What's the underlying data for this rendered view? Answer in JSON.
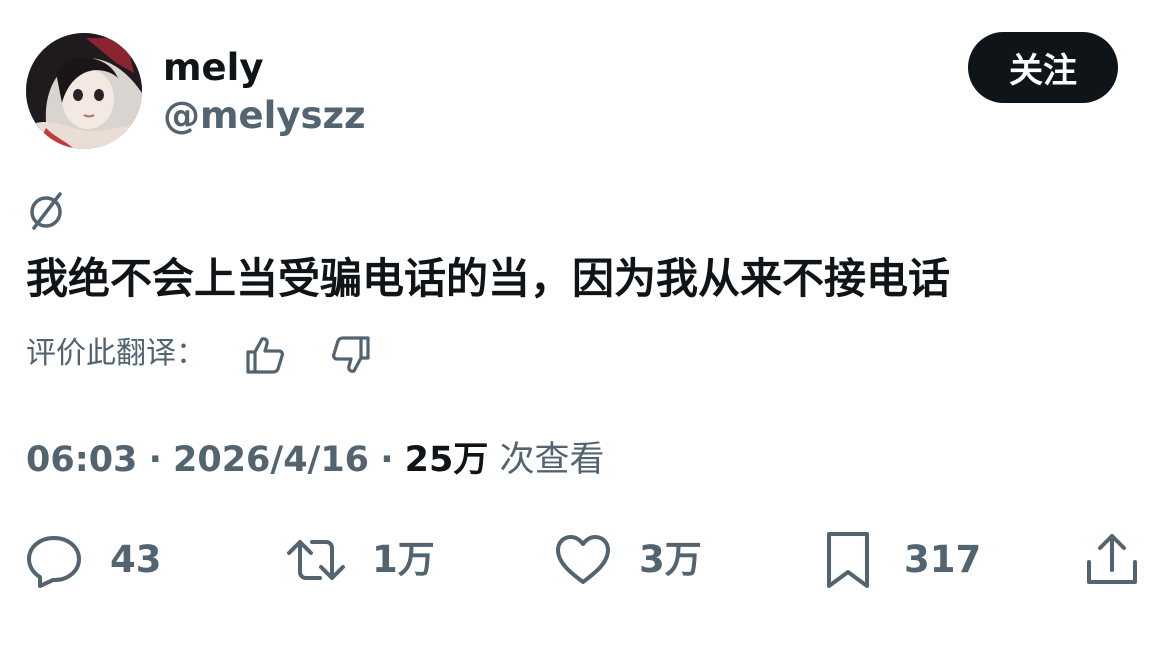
{
  "user": {
    "display_name": "mely",
    "handle": "@melyszz",
    "follow_label": "关注"
  },
  "tweet": {
    "text": "我绝不会上当受骗电话的当，因为我从来不接电话",
    "rate_translation_label": "评价此翻译：",
    "time": "06:03",
    "separator": "·",
    "date": "2026/4/16",
    "views_count": "25万",
    "views_label": "次查看"
  },
  "actions": {
    "replies": "43",
    "retweets": "1万",
    "likes": "3万",
    "bookmarks": "317"
  },
  "icons": {
    "translate": "translate-icon",
    "thumbs_up": "thumbs-up-icon",
    "thumbs_down": "thumbs-down-icon",
    "reply": "reply-icon",
    "retweet": "retweet-icon",
    "like": "heart-icon",
    "bookmark": "bookmark-icon",
    "share": "share-icon"
  },
  "colors": {
    "primary_text": "#0f1419",
    "secondary_text": "#536471",
    "follow_button_bg": "#0f1419",
    "background": "#ffffff"
  }
}
